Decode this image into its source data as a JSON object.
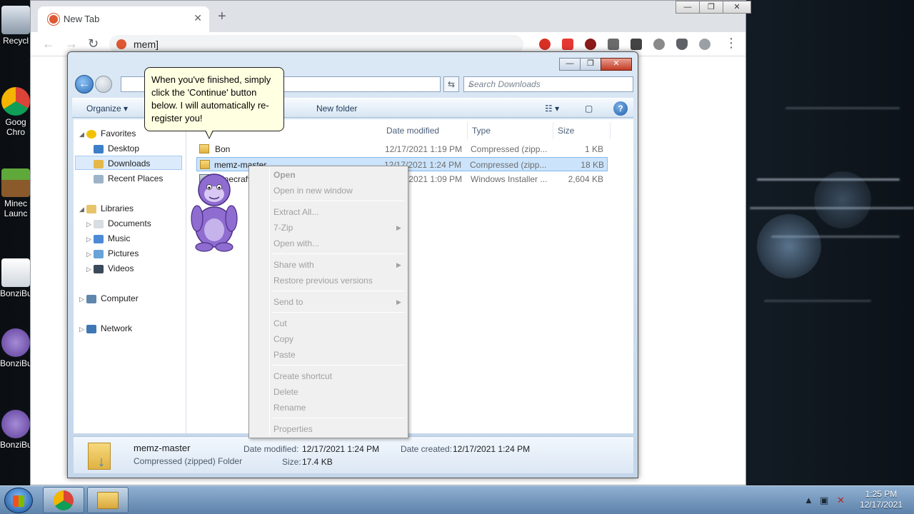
{
  "desktop": {
    "icons": [
      {
        "label": "Recycl"
      },
      {
        "label": "Goog",
        "label2": "Chro"
      },
      {
        "label": "Minec",
        "label2": "Launc"
      },
      {
        "label": "BonziBu"
      },
      {
        "label": "BonziBu"
      },
      {
        "label": "BonziBu"
      }
    ]
  },
  "browser": {
    "tab_title": "New Tab",
    "tab_close": "✕",
    "new_tab": "+",
    "address_value": "mem]",
    "back": "←",
    "forward": "→",
    "reload": "↻",
    "min": "—",
    "max": "❐",
    "close": "✕",
    "menu": "⋮"
  },
  "explorer": {
    "search_placeholder": "Search Downloads",
    "organize": "Organize ▾",
    "new_folder": "New folder",
    "min": "—",
    "max": "❐",
    "close": "✕",
    "nav": {
      "favorites": "Favorites",
      "desktop": "Desktop",
      "downloads": "Downloads",
      "recent": "Recent Places",
      "libraries": "Libraries",
      "documents": "Documents",
      "music": "Music",
      "pictures": "Pictures",
      "videos": "Videos",
      "computer": "Computer",
      "network": "Network"
    },
    "columns": {
      "modified": "Date modified",
      "type": "Type",
      "size": "Size"
    },
    "files": [
      {
        "name": "Bon",
        "modified": "12/17/2021 1:19 PM",
        "type": "Compressed (zipp...",
        "size": "1 KB"
      },
      {
        "name": "memz-master",
        "modified": "12/17/2021 1:24 PM",
        "type": "Compressed (zipp...",
        "size": "18 KB"
      },
      {
        "name": "MinecraftInstaller",
        "modified": "12/17/2021 1:09 PM",
        "type": "Windows Installer ...",
        "size": "2,604 KB"
      }
    ],
    "details": {
      "name": "memz-master",
      "kind": "Compressed (zipped) Folder",
      "modified_label": "Date modified:",
      "modified": "12/17/2021 1:24 PM",
      "created_label": "Date created:",
      "created": "12/17/2021 1:24 PM",
      "size_label": "Size:",
      "size": "17.4 KB"
    }
  },
  "context_menu": {
    "open": "Open",
    "open_new_window": "Open in new window",
    "extract_all": "Extract All...",
    "seven_zip": "7-Zip",
    "open_with": "Open with...",
    "share_with": "Share with",
    "restore": "Restore previous versions",
    "send_to": "Send to",
    "cut": "Cut",
    "copy": "Copy",
    "paste": "Paste",
    "create_shortcut": "Create shortcut",
    "delete": "Delete",
    "rename": "Rename",
    "properties": "Properties",
    "submenu_arrow": "▶"
  },
  "balloon": {
    "text": "When you've finished, simply click the 'Continue' button below. I will automatically re-register you!"
  },
  "taskbar": {
    "time": "1:25 PM",
    "date": "12/17/2021"
  },
  "colors": {
    "chrome_tab_bg": "#dee1e6",
    "explorer_accent": "#1e395b",
    "balloon_bg": "#ffffe1",
    "selection": "#cce4fb"
  }
}
